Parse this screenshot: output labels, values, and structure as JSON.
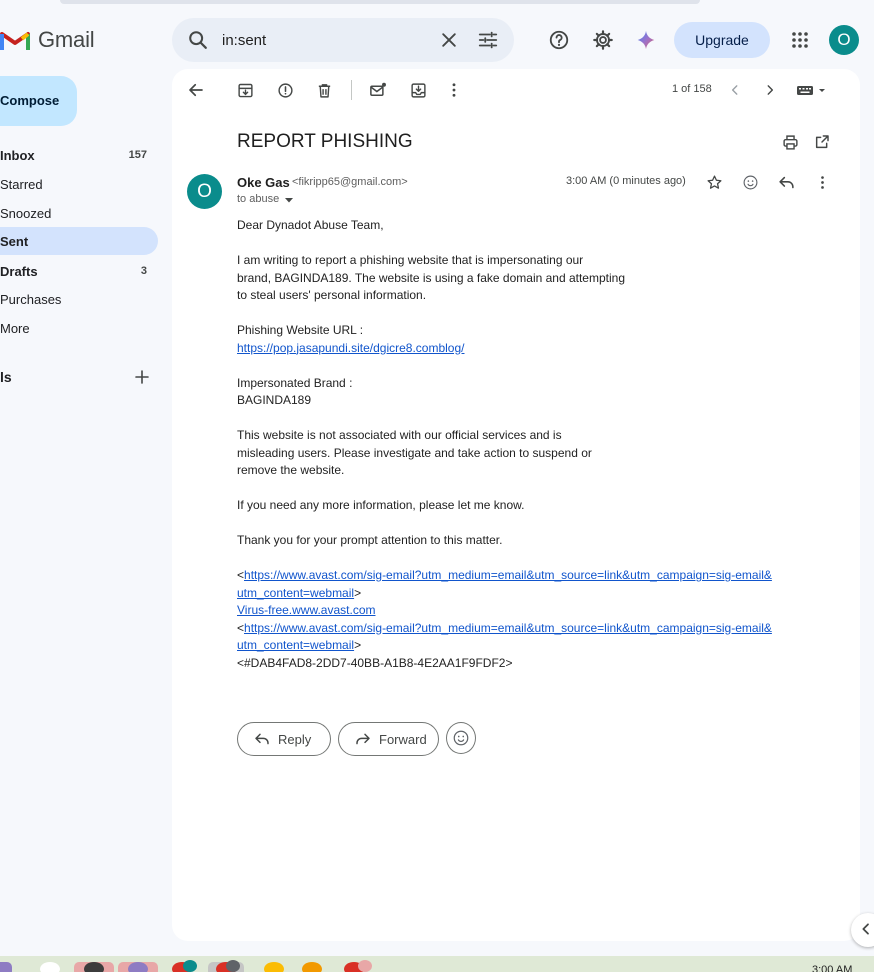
{
  "app": {
    "name": "Gmail"
  },
  "search": {
    "value": "in:sent"
  },
  "header": {
    "upgrade_label": "Upgrade",
    "avatar_initial": "O"
  },
  "sidebar": {
    "compose_label": "Compose",
    "items": [
      {
        "label": "Inbox",
        "count": "157"
      },
      {
        "label": "Starred",
        "count": ""
      },
      {
        "label": "Snoozed",
        "count": ""
      },
      {
        "label": "Sent",
        "count": ""
      },
      {
        "label": "Drafts",
        "count": "3"
      },
      {
        "label": "Purchases",
        "count": ""
      },
      {
        "label": "More",
        "count": ""
      }
    ],
    "labels_heading": "ls"
  },
  "toolbar": {
    "pagination": "1 of 158"
  },
  "email": {
    "subject": "REPORT PHISHING",
    "sender_initial": "O",
    "sender_name": "Oke Gas",
    "sender_email": "<fikripp65@gmail.com>",
    "recipient": "to abuse",
    "timestamp": "3:00 AM (0 minutes ago)",
    "greeting": "Dear Dynadot Abuse Team,",
    "para1": [
      "I am writing to report a phishing website that is impersonating our",
      "brand, BAGINDA189. The website is using a fake domain and attempting",
      "to steal users' personal information."
    ],
    "url_label": "Phishing Website URL :",
    "url": "https://pop.jasapundi.site/dgicre8.comblog/",
    "brand_label": "Impersonated Brand :",
    "brand": "BAGINDA189",
    "para2": [
      "This website is not associated with our official services and is",
      "misleading users. Please investigate and take action to suspend or",
      "remove the website."
    ],
    "para3": "If you need any more information, please let me know.",
    "para4": "Thank you for your prompt attention to this matter.",
    "sig_link_line1": "https://www.avast.com/sig-email?utm_medium=email&utm_source=link&utm_campaign=sig-email&",
    "sig_link_line2": "utm_content=webmail",
    "sig_text": "Virus-free.www.avast.com",
    "sig_id": "<#DAB4FAD8-2DD7-40BB-A1B8-4E2AA1F9FDF2>",
    "angle_open": "<",
    "angle_close": ">"
  },
  "actions": {
    "reply_label": "Reply",
    "forward_label": "Forward"
  },
  "taskbar": {
    "clock": "3:00 AM"
  },
  "colors": {
    "accent": "#0b57d0",
    "compose": "#c2e7ff",
    "active_nav": "#d3e3fd",
    "avatar": "#0a8c8c",
    "link": "#1155cc"
  }
}
